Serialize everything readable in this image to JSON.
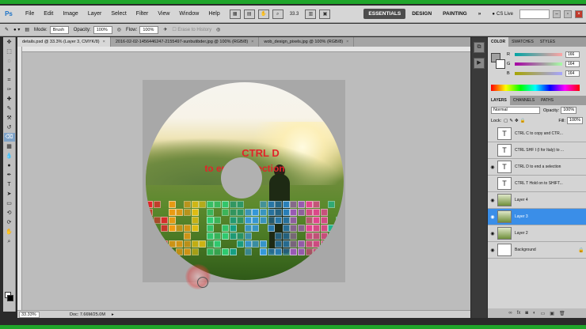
{
  "app": {
    "logo": "Ps"
  },
  "menu": [
    "File",
    "Edit",
    "Image",
    "Layer",
    "Select",
    "Filter",
    "View",
    "Window",
    "Help"
  ],
  "menubar_zoom": "33.3",
  "workspaces": [
    "ESSENTIALS",
    "DESIGN",
    "PAINTING"
  ],
  "more_label": "»",
  "cslive": "CS Live",
  "options": {
    "mode_label": "Mode:",
    "mode_value": "Brush",
    "opacity_label": "Opacity:",
    "opacity_value": "100%",
    "flow_label": "Flow:",
    "flow_value": "100%",
    "erase_history": "Erase to History"
  },
  "tabs": [
    {
      "label": "details.psd @ 33.3% (Layer 3, CMYK/8)"
    },
    {
      "label": "2016-02-02-1456446247-2155497-sunbutibder.jpg @ 100% (RGB/8)"
    },
    {
      "label": "wob_design_pixels.jpg @ 100% (RGB/8)"
    }
  ],
  "canvas": {
    "line1": "CTRL D",
    "line2": "to end a selection"
  },
  "status": {
    "zoom": "33.33%",
    "doc": "Doc: 7.66M/25.0M"
  },
  "color_panel": {
    "tabs": [
      "COLOR",
      "SWATCHES",
      "STYLES"
    ],
    "channels": [
      {
        "label": "R",
        "value": "166"
      },
      {
        "label": "G",
        "value": "164"
      },
      {
        "label": "B",
        "value": "164"
      }
    ]
  },
  "layers_panel": {
    "tabs": [
      "LAYERS",
      "CHANNELS",
      "PATHS"
    ],
    "blend": "Normal",
    "opacity_label": "Opacity:",
    "opacity": "100%",
    "lock_label": "Lock:",
    "fill_label": "Fill:",
    "fill": "100%",
    "layers": [
      {
        "name": "CTRL C to copy and  CTR...",
        "type": "text",
        "visible": false
      },
      {
        "name": "CTRL SHF I (I for Italy) to ...",
        "type": "text",
        "visible": false
      },
      {
        "name": "CTRL D to end a selection",
        "type": "text",
        "visible": true
      },
      {
        "name": "CTRL T Hold on to SHIFT...",
        "type": "text",
        "visible": false
      },
      {
        "name": "Layer 4",
        "type": "image",
        "visible": true
      },
      {
        "name": "Layer 3",
        "type": "image",
        "visible": true,
        "active": true
      },
      {
        "name": "Layer 2",
        "type": "image",
        "visible": true
      },
      {
        "name": "Background",
        "type": "bg",
        "visible": true
      }
    ]
  },
  "colors": {
    "accent": "#3a8ee8",
    "text_red": "#e0252a",
    "green_bar": "#1fa52a"
  }
}
